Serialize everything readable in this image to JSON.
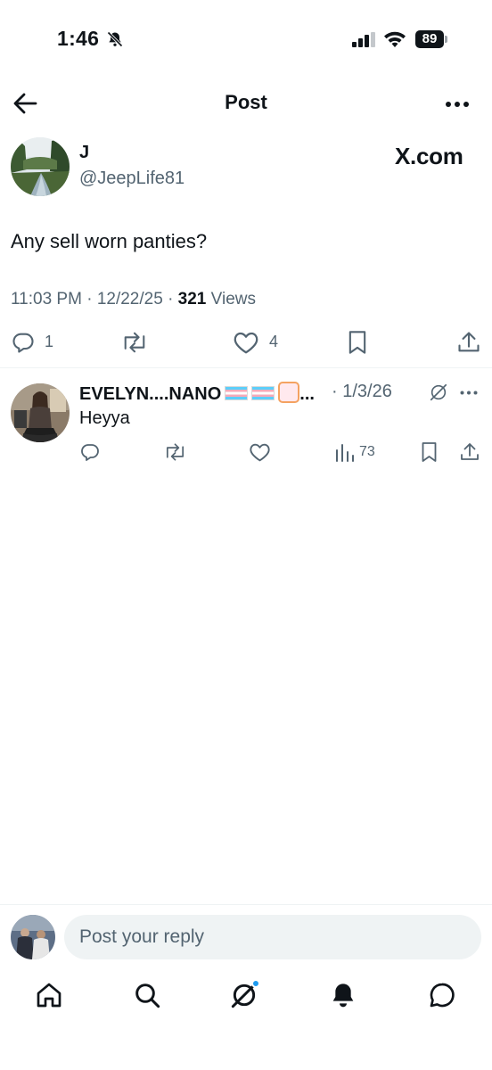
{
  "status_bar": {
    "time": "1:46",
    "battery": "89",
    "icons": [
      "bell-slash-icon",
      "signal-icon",
      "wifi-icon",
      "battery-icon"
    ]
  },
  "header": {
    "title": "Post",
    "back_icon": "arrow-left-icon",
    "more_icon": "more-horizontal-icon"
  },
  "post": {
    "author_name": "J",
    "author_handle": "@JeepLife81",
    "source_label": "X.com",
    "text": "Any sell worn panties?",
    "time": "11:03 PM",
    "date": "12/22/25",
    "views_count": "321",
    "views_label": "Views",
    "actions": {
      "reply_count": "1",
      "like_count": "4"
    }
  },
  "reply": {
    "author_name": "EVELYN....NANO",
    "ellipsis": "...",
    "date": "· 1/3/26",
    "text": "Heyya",
    "views_count": "73"
  },
  "composer": {
    "placeholder": "Post your reply"
  },
  "bottom_nav": [
    "home-icon",
    "search-icon",
    "grok-icon",
    "notifications-icon",
    "messages-icon"
  ],
  "colors": {
    "text": "#0f1419",
    "secondary": "#536471",
    "divider": "#eff3f4",
    "accent": "#1d9bf0"
  }
}
